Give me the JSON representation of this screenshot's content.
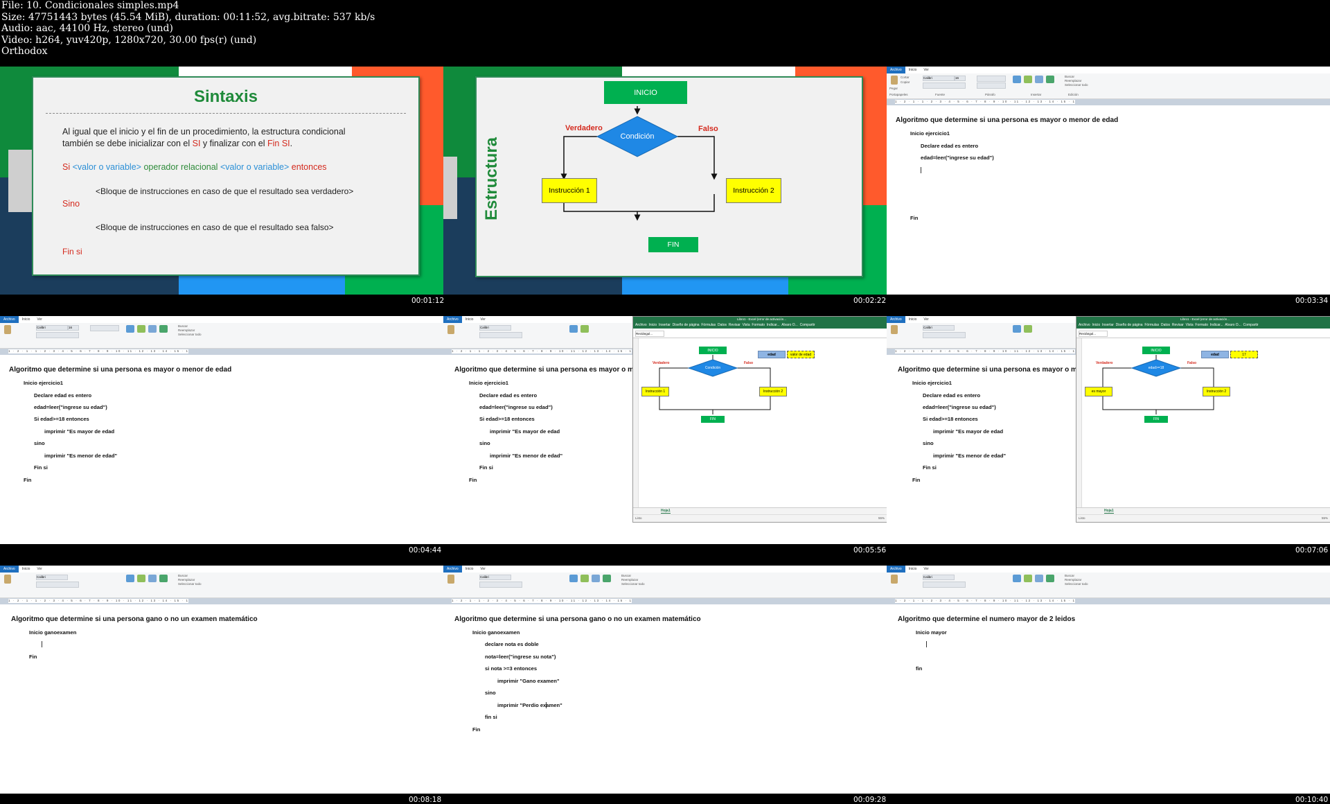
{
  "header": {
    "file": "File: 10. Condicionales simples.mp4",
    "size": "Size: 47751443 bytes (45.54 MiB), duration: 00:11:52, avg.bitrate: 537 kb/s",
    "audio": "Audio: aac, 44100 Hz, stereo (und)",
    "video": "Video: h264, yuv420p, 1280x720, 30.00 fps(r) (und)",
    "author": "Orthodox"
  },
  "timestamps": [
    "00:01:12",
    "00:02:22",
    "00:03:34",
    "00:04:44",
    "00:05:56",
    "00:07:06",
    "00:08:18",
    "00:09:28",
    "00:10:40"
  ],
  "colors": {
    "green": "#0f8a3c",
    "red": "#d42a1e",
    "blue": "#1f88e5",
    "yellow": "#ffff00",
    "navy": "#1b3d5c",
    "orange": "#ff5a2c",
    "brightgreen": "#00b050"
  },
  "slide1": {
    "title": "Sintaxis",
    "para1": "Al igual que el inicio y el fin de un procedimiento, la estructura condicional",
    "para2a": "también se debe inicializar con el ",
    "para2b": "SI",
    "para2c": " y finalizar con el ",
    "para2d": "Fin SI",
    "para2e": ".",
    "syn_si": "Si ",
    "syn_val1": "<valor o variable>",
    "syn_op": " operador relacional ",
    "syn_val2": "<valor o variable>",
    "syn_ent": " entonces",
    "block_true": "<Bloque de instrucciones en caso de que el resultado sea verdadero>",
    "sino": "Sino",
    "block_false": "<Bloque de instrucciones en caso de que el resultado sea falso>",
    "finsi": "Fin si"
  },
  "slide2": {
    "side_title": "Estructura",
    "inicio": "INICIO",
    "condicion": "Condición",
    "verdadero": "Verdadero",
    "falso": "Falso",
    "instr1": "Instrucción 1",
    "instr2": "Instrucción 2",
    "fin": "FIN"
  },
  "wordpad": {
    "tabs": [
      "Archivo",
      "Inicio",
      "Ver"
    ],
    "font": "Calibri",
    "size": "16",
    "groups": [
      "Portapapeles",
      "Fuente",
      "Párrafo",
      "Insertar",
      "Edición"
    ],
    "edit_buttons": [
      "Buscar",
      "Reemplazar",
      "Seleccionar todo"
    ],
    "insert_buttons": [
      "Imagen",
      "Pintar dibujo",
      "Fecha y hora",
      "Insertar objeto"
    ],
    "paste": "Pegar",
    "cut": "Cortar",
    "copy": "Copiar",
    "ruler": "1 · 2 · 1 · 1 · 2 · 3 · 4 · 5 · 6 · 7 · 8 · 9 · 10 · 11 · 12 · 13 · 14 · 15 · 16 · 17 · 18"
  },
  "doc_mayor": {
    "title": "Algoritmo que determine si una persona es mayor o menor de edad",
    "inicio": "Inicio ejercicio1",
    "declare": "Declare edad es entero",
    "leer": "edad=leer(\"ingrese su edad\")",
    "si": "Si edad>=18 entonces",
    "imp_mayor": "imprimir \"Es mayor de edad",
    "sino": "sino",
    "imp_menor": "imprimir \"Es menor de edad\"",
    "finsi": "Fin si",
    "fin": "Fin"
  },
  "doc_examen": {
    "title": "Algoritmo que determine si una persona gano o no un examen matemático",
    "inicio": "Inicio ganoexamen",
    "declare": "declare nota es doble",
    "leer": "nota=leer(\"ingrese su nota\")",
    "si": "si nota >=3 entonces",
    "imp_gano": "imprimir \"Gano examen\"",
    "sino": "sino",
    "imp_perdio": "imprimir \"Perdio examen\"",
    "finsi": "fin si",
    "fin": "Fin"
  },
  "doc_numero": {
    "title": "Algoritmo que determine el numero mayor de 2 leidos",
    "inicio": "Inicio mayor",
    "fin": "fin"
  },
  "excel": {
    "title": "Libro1 - Excel (error de activación...",
    "menu": [
      "Archivo",
      "Inicio",
      "Insertar",
      "Diseño de página",
      "Fórmulas",
      "Datos",
      "Revisar",
      "Vista",
      "Formato",
      "Indicar...",
      "Alvaro O...",
      "Compartir"
    ],
    "namebox": "Rectángul...",
    "sheet": "Hoja1",
    "status": "Listo",
    "zoom": "55%",
    "inicio": "INICIO",
    "condicion": "Condición",
    "condicion2": "edad>=18",
    "verdadero": "Verdadero",
    "falso": "Falso",
    "instr1": "Instrucción 1",
    "instr1b": "es mayor",
    "instr2": "Instrucción 2",
    "fin": "FIN",
    "var_label": "edad",
    "var_value": "valor de edad",
    "var_value2": "17"
  }
}
